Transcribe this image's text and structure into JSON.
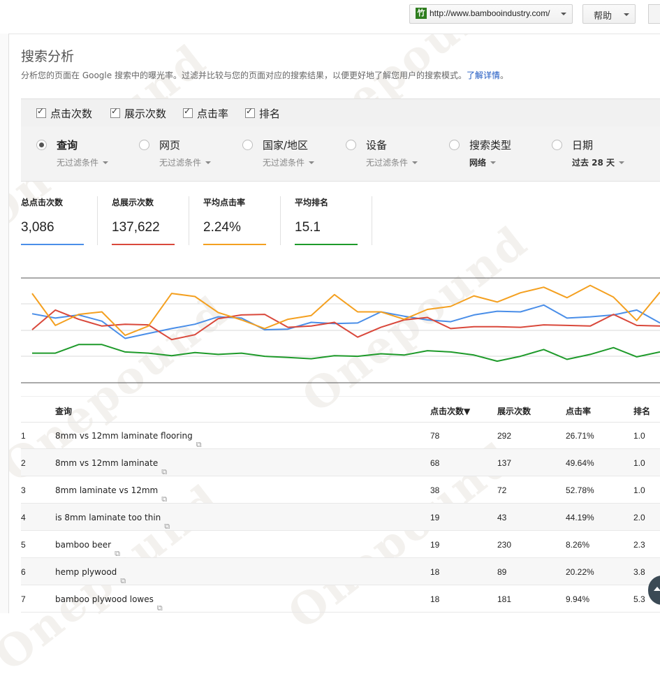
{
  "header": {
    "site_url": "http://www.bambooindustry.com/",
    "favicon_text": "竹",
    "help_label": "帮助"
  },
  "page": {
    "title": "搜索分析",
    "description": "分析您的页面在 Google 搜索中的曝光率。过滤并比较与您的页面对应的搜索结果，以便更好地了解您用户的搜索模式。",
    "learn_more": "了解详情"
  },
  "metrics": [
    {
      "label": "点击次数",
      "checked": true
    },
    {
      "label": "展示次数",
      "checked": true
    },
    {
      "label": "点击率",
      "checked": true
    },
    {
      "label": "排名",
      "checked": true
    }
  ],
  "dimensions": [
    {
      "label": "查询",
      "sub": "无过滤条件",
      "selected": true
    },
    {
      "label": "网页",
      "sub": "无过滤条件",
      "selected": false
    },
    {
      "label": "国家/地区",
      "sub": "无过滤条件",
      "selected": false
    },
    {
      "label": "设备",
      "sub": "无过滤条件",
      "selected": false
    },
    {
      "label": "搜索类型",
      "sub": "网络",
      "selected": false
    },
    {
      "label": "日期",
      "sub": "过去 28 天",
      "selected": false
    }
  ],
  "summary": [
    {
      "label": "总点击次数",
      "value": "3,086",
      "color": "#4a8ee8"
    },
    {
      "label": "总展示次数",
      "value": "137,622",
      "color": "#d9483b"
    },
    {
      "label": "平均点击率",
      "value": "2.24%",
      "color": "#f4a020"
    },
    {
      "label": "平均排名",
      "value": "15.1",
      "color": "#1e9a2a"
    }
  ],
  "chart_data": {
    "type": "line",
    "x": [
      1,
      2,
      3,
      4,
      5,
      6,
      7,
      8,
      9,
      10,
      11,
      12,
      13,
      14,
      15,
      16,
      17,
      18,
      19,
      20,
      21,
      22,
      23,
      24,
      25,
      26,
      27,
      28
    ],
    "series": [
      {
        "name": "点击次数",
        "color": "#4a8ee8",
        "values": [
          112,
          105,
          110,
          100,
          72,
          80,
          88,
          95,
          107,
          105,
          86,
          87,
          98,
          96,
          97,
          115,
          108,
          102,
          99,
          110,
          116,
          115,
          126,
          105,
          107,
          110,
          118,
          97
        ]
      },
      {
        "name": "展示次数",
        "color": "#d9483b",
        "values": [
          86,
          118,
          103,
          92,
          95,
          94,
          70,
          78,
          104,
          110,
          111,
          90,
          92,
          98,
          74,
          90,
          102,
          106,
          88,
          91,
          91,
          90,
          94,
          93,
          92,
          111,
          93,
          92
        ]
      },
      {
        "name": "点击率",
        "color": "#f4a020",
        "values": [
          145,
          93,
          111,
          115,
          77,
          92,
          145,
          140,
          114,
          102,
          88,
          103,
          109,
          143,
          115,
          115,
          103,
          119,
          124,
          141,
          131,
          146,
          155,
          138,
          158,
          139,
          101,
          147
        ]
      },
      {
        "name": "排名",
        "color": "#1e9a2a",
        "values": [
          48,
          48,
          62,
          62,
          50,
          48,
          44,
          49,
          46,
          48,
          43,
          41,
          39,
          44,
          43,
          47,
          45,
          52,
          50,
          45,
          35,
          43,
          54,
          38,
          46,
          57,
          42,
          50
        ]
      }
    ]
  },
  "table": {
    "headers": {
      "query": "查询",
      "clicks": "点击次数▼",
      "impressions": "展示次数",
      "ctr": "点击率",
      "position": "排名"
    },
    "rows": [
      {
        "num": "1",
        "query": "8mm vs 12mm laminate flooring",
        "clicks": "78",
        "impressions": "292",
        "ctr": "26.71%",
        "position": "1.0"
      },
      {
        "num": "2",
        "query": "8mm vs 12mm laminate",
        "clicks": "68",
        "impressions": "137",
        "ctr": "49.64%",
        "position": "1.0"
      },
      {
        "num": "3",
        "query": "8mm laminate vs 12mm",
        "clicks": "38",
        "impressions": "72",
        "ctr": "52.78%",
        "position": "1.0"
      },
      {
        "num": "4",
        "query": "is 8mm laminate too thin",
        "clicks": "19",
        "impressions": "43",
        "ctr": "44.19%",
        "position": "2.0"
      },
      {
        "num": "5",
        "query": "bamboo beer",
        "clicks": "19",
        "impressions": "230",
        "ctr": "8.26%",
        "position": "2.3"
      },
      {
        "num": "6",
        "query": "hemp plywood",
        "clicks": "18",
        "impressions": "89",
        "ctr": "20.22%",
        "position": "3.8"
      },
      {
        "num": "7",
        "query": "bamboo plywood lowes",
        "clicks": "18",
        "impressions": "181",
        "ctr": "9.94%",
        "position": "5.3"
      }
    ]
  },
  "watermark": "Onepound"
}
